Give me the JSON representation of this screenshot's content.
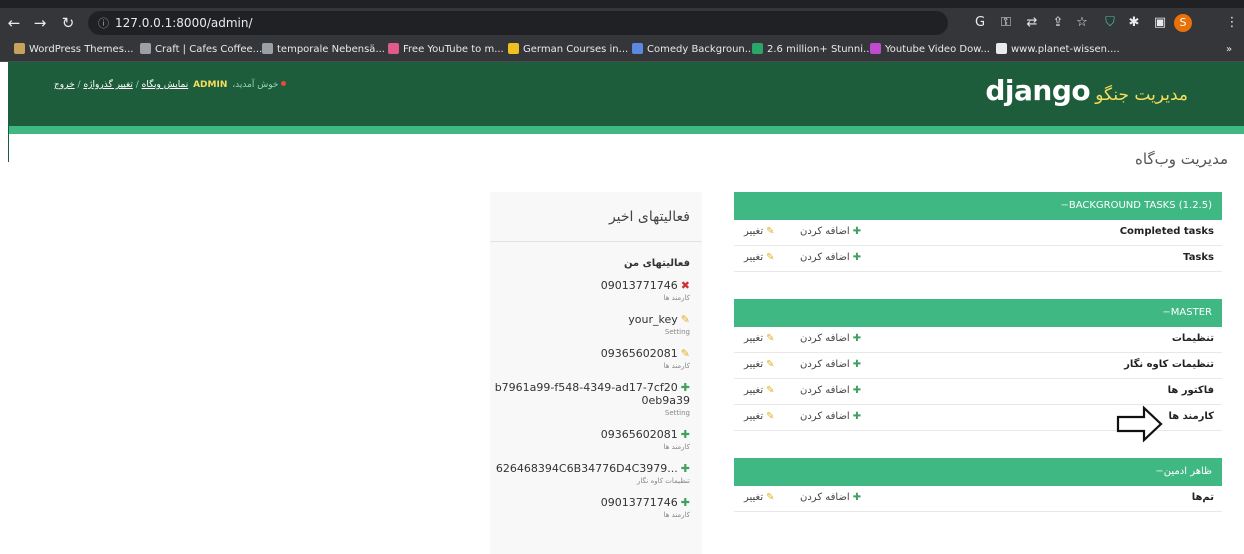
{
  "browser": {
    "url": "127.0.0.1:8000/admin/",
    "profile_letter": "S",
    "bookmarks": [
      {
        "label": "WordPress Themes...",
        "color": "#c8a15a"
      },
      {
        "label": "Craft | Cafes Coffee...",
        "color": "#9aa0a6"
      },
      {
        "label": "temporale Nebensä...",
        "color": "#9aa0a6"
      },
      {
        "label": "Free YouTube to m...",
        "color": "#e05a8a"
      },
      {
        "label": "German Courses in...",
        "color": "#f0c020"
      },
      {
        "label": "Comedy Backgroun...",
        "color": "#5a8ae0"
      },
      {
        "label": "2.6 million+ Stunni...",
        "color": "#2ba56a"
      },
      {
        "label": "Youtube Video Dow...",
        "color": "#c04ad0"
      },
      {
        "label": "www.planet-wissen....",
        "color": "#e8eaed"
      }
    ],
    "more_bookmarks": "»"
  },
  "header": {
    "brand": "django",
    "brand_sub": "مدیریت جنگو",
    "welcome": "خوش آمدید،",
    "username": "ADMIN",
    "links": {
      "view_site": "نمایش وبگاه",
      "change_password": "تغییر گذرواژه",
      "logout": "خروج"
    }
  },
  "page_title": "مدیریت وب‌گاه",
  "apps": [
    {
      "caption": "BACKGROUND TASKS (1.2.5)",
      "models": [
        {
          "name": "Completed tasks",
          "add": "اضافه کردن",
          "change": "تغییر"
        },
        {
          "name": "Tasks",
          "add": "اضافه کردن",
          "change": "تغییر"
        }
      ]
    },
    {
      "caption": "MASTER",
      "models": [
        {
          "name": "تنظیمات",
          "add": "اضافه کردن",
          "change": "تغییر"
        },
        {
          "name": "تنظیمات کاوه نگار",
          "add": "اضافه کردن",
          "change": "تغییر"
        },
        {
          "name": "فاکتور ها",
          "add": "اضافه کردن",
          "change": "تغییر"
        },
        {
          "name": "کارمند ها",
          "add": "اضافه کردن",
          "change": "تغییر"
        }
      ]
    },
    {
      "caption": "ظاهر ادمین",
      "models": [
        {
          "name": "تم‌ها",
          "add": "اضافه کردن",
          "change": "تغییر"
        }
      ]
    }
  ],
  "recent": {
    "title": "فعالیتهای اخیر",
    "subtitle": "فعالیتهای من",
    "items": [
      {
        "action": "delete",
        "name": "09013771746",
        "type": "کارمند ها"
      },
      {
        "action": "change",
        "name": "your_key",
        "type": "Setting"
      },
      {
        "action": "change",
        "name": "09365602081",
        "type": "کارمند ها"
      },
      {
        "action": "add",
        "name": "b7961a99-f548-4349-ad17-7cf200eb9a39",
        "type": "Setting"
      },
      {
        "action": "add",
        "name": "09365602081",
        "type": "کارمند ها"
      },
      {
        "action": "add",
        "name": "...626468394C6B34776D4C3979",
        "type": "تنظیمات کاوه نگار"
      },
      {
        "action": "add",
        "name": "09013771746",
        "type": "کارمند ها"
      }
    ]
  },
  "colors": {
    "header_bg": "#1e5d3c",
    "accent": "#40b883",
    "brand_sub": "#f5dd5d"
  }
}
